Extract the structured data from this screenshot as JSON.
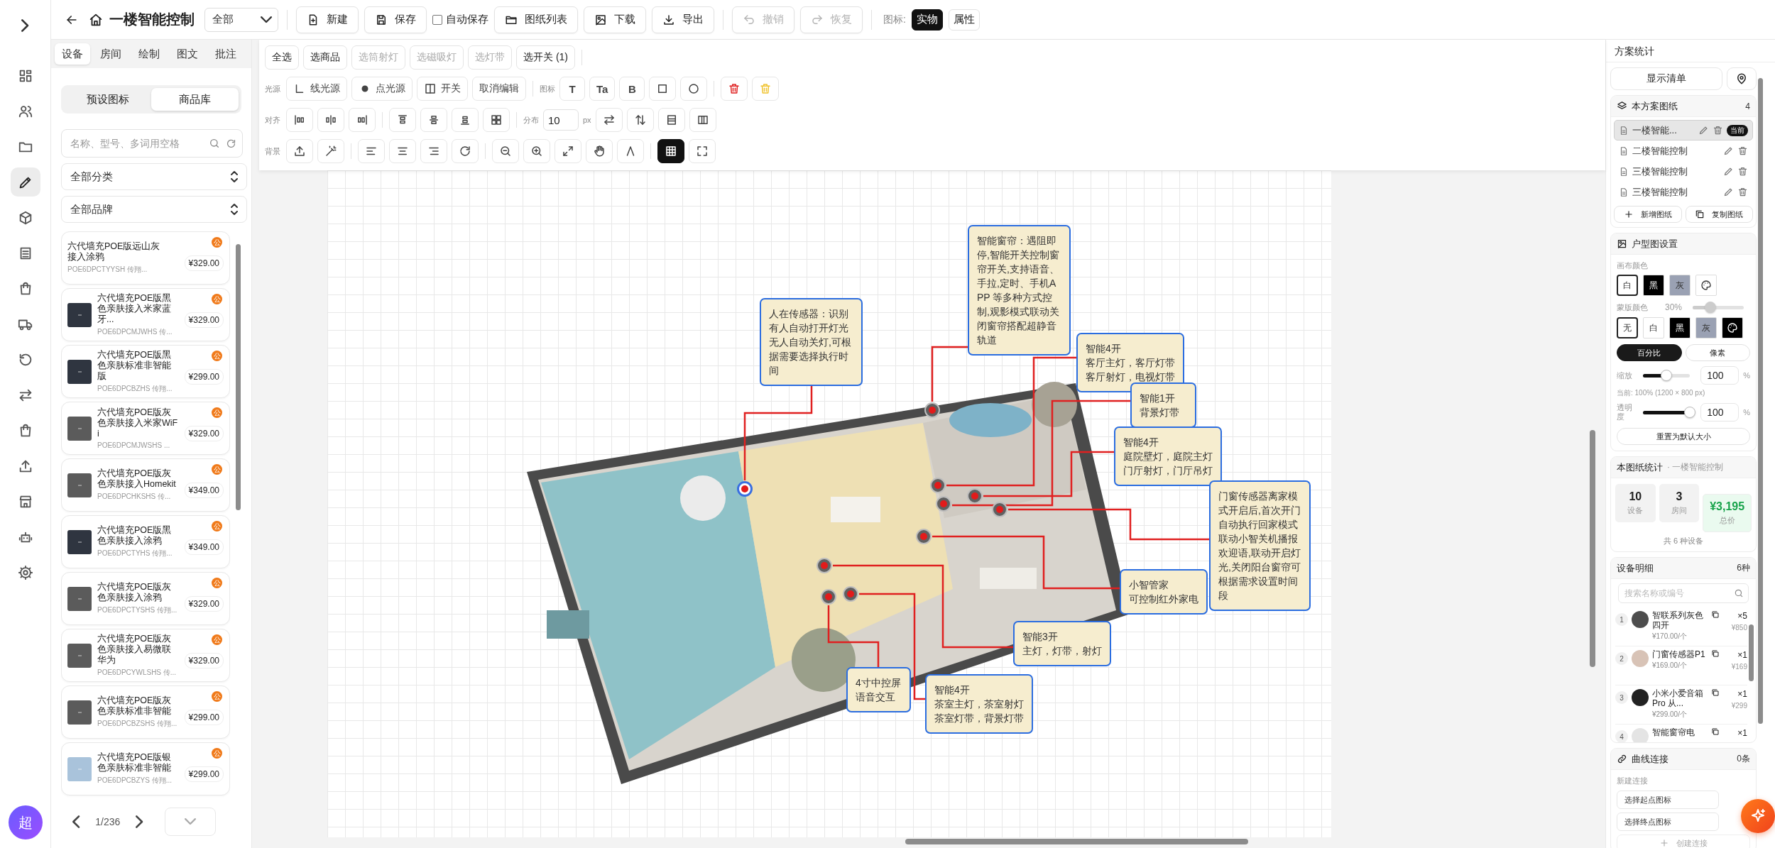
{
  "rail": {
    "items": [
      {
        "kind": "dashboard",
        "selected": false
      },
      {
        "kind": "users",
        "selected": false
      },
      {
        "kind": "folder",
        "selected": false
      },
      {
        "kind": "pen",
        "selected": true
      },
      {
        "kind": "cube",
        "selected": false
      },
      {
        "kind": "archive",
        "selected": false
      },
      {
        "kind": "bag",
        "selected": false
      },
      {
        "kind": "truck",
        "selected": false
      },
      {
        "kind": "history",
        "selected": false
      },
      {
        "kind": "swap",
        "selected": false
      },
      {
        "kind": "bag",
        "selected": false
      },
      {
        "kind": "upload",
        "selected": false
      },
      {
        "kind": "store",
        "selected": false
      },
      {
        "kind": "robot",
        "selected": false
      },
      {
        "kind": "settings",
        "selected": false
      }
    ],
    "avatar": "超"
  },
  "topbar": {
    "title": "一楼智能控制",
    "scope": "全部",
    "actions": [
      {
        "kind": "new",
        "label": "新建"
      },
      {
        "kind": "save",
        "label": "保存"
      },
      {
        "kind": "checkbox",
        "label": "自动保存",
        "checked": false
      },
      {
        "kind": "list",
        "label": "图纸列表"
      },
      {
        "kind": "download",
        "label": "下载"
      },
      {
        "kind": "export",
        "label": "导出"
      }
    ],
    "history": [
      {
        "kind": "undo",
        "label": "撤销",
        "disabled": true
      },
      {
        "kind": "redo",
        "label": "恢复",
        "disabled": true
      }
    ],
    "icon_mode_label": "图标:",
    "icon_modes": [
      {
        "label": "实物",
        "selected": true
      },
      {
        "label": "属性",
        "selected": false
      }
    ]
  },
  "left_panel": {
    "tabs": [
      {
        "label": "设备",
        "selected": true
      },
      {
        "label": "房间",
        "selected": false
      },
      {
        "label": "绘制",
        "selected": false
      },
      {
        "label": "图文",
        "selected": false
      },
      {
        "label": "批注",
        "selected": false
      }
    ],
    "sources": [
      {
        "label": "预设图标",
        "selected": false
      },
      {
        "label": "商品库",
        "selected": true
      }
    ],
    "search": {
      "placeholder": "名称、型号、多词用空格"
    },
    "filters": [
      "全部分类",
      "全部品牌"
    ],
    "products": [
      {
        "name": "六代墙充POE版远山灰接入涂鸦",
        "code": "POE6DPCTYYSH 传翔...",
        "price": "¥329.00",
        "badge": "公"
      },
      {
        "name": "六代墙充POE版黑色亲肤接入米家蓝牙...",
        "code": "POE6DPCMJWHS 传...",
        "price": "¥329.00",
        "badge": "公",
        "color": "#2f3540"
      },
      {
        "name": "六代墙充POE版黑色亲肤标准非智能版",
        "code": "POE6DPCBZHS 传翔...",
        "price": "¥299.00",
        "badge": "公",
        "color": "#2f3540"
      },
      {
        "name": "六代墙充POE版灰色亲肤接入米家WiFi",
        "code": "POE6DPCMJWSHS ...",
        "price": "¥329.00",
        "badge": "公",
        "color": "#5b5b5b"
      },
      {
        "name": "六代墙充POE版灰色亲肤接入Homekit",
        "code": "POE6DPCHKSHS 传...",
        "price": "¥349.00",
        "badge": "公",
        "color": "#5b5b5b"
      },
      {
        "name": "六代墙充POE版黑色亲肤接入涂鸦",
        "code": "POE6DPCTYHS 传翔...",
        "price": "¥349.00",
        "badge": "公",
        "color": "#2f3540"
      },
      {
        "name": "六代墙充POE版灰色亲肤接入涂鸦",
        "code": "POE6DPCTYSHS 传翔...",
        "price": "¥329.00",
        "badge": "公",
        "color": "#5b5b5b"
      },
      {
        "name": "六代墙充POE版灰色亲肤接入易微联华为",
        "code": "POE6DPCYWLSHS 传...",
        "price": "¥329.00",
        "badge": "公",
        "color": "#5b5b5b"
      },
      {
        "name": "六代墙充POE版灰色亲肤标准非智能",
        "code": "POE6DPCBZSHS 传翔...",
        "price": "¥299.00",
        "badge": "公",
        "color": "#5b5b5b"
      },
      {
        "name": "六代墙充POE版银色亲肤标准非智能",
        "code": "POE6DPCBZYS 传翔...",
        "price": "¥299.00",
        "badge": "公",
        "color": "#a9c3db"
      }
    ],
    "pagination": {
      "page": "1/236"
    }
  },
  "toolbar": {
    "selection": [
      {
        "label": "全选",
        "disabled": false
      },
      {
        "label": "选商品",
        "disabled": false
      },
      {
        "label": "选筒射灯",
        "disabled": true
      },
      {
        "label": "选磁吸灯",
        "disabled": true
      },
      {
        "label": "选灯带",
        "disabled": true
      },
      {
        "label": "选开关 (1)",
        "disabled": false
      }
    ],
    "rows": [
      {
        "label": "光源",
        "groups": [
          [
            {
              "kind": "line-light",
              "label": "线光源"
            },
            {
              "kind": "point-light",
              "label": "点光源"
            },
            {
              "kind": "switch",
              "label": "开关"
            },
            {
              "kind": "plain",
              "label": "取消编辑"
            }
          ],
          [
            {
              "kind": "caption",
              "label": "图标"
            },
            {
              "kind": "glyph",
              "label": "T"
            },
            {
              "kind": "glyph",
              "label": "Ta"
            },
            {
              "kind": "glyph",
              "label": "B"
            },
            {
              "kind": "square"
            },
            {
              "kind": "circle"
            }
          ],
          [
            {
              "kind": "delete"
            },
            {
              "kind": "delete-soft"
            }
          ]
        ]
      },
      {
        "label": "对齐",
        "groups": [
          [
            {
              "kind": "align-left"
            },
            {
              "kind": "align-center"
            },
            {
              "kind": "align-right"
            }
          ],
          [
            {
              "kind": "align-top"
            },
            {
              "kind": "align-middle"
            },
            {
              "kind": "align-bottom"
            },
            {
              "kind": "tile"
            }
          ],
          [
            {
              "kind": "caption",
              "label": "分布"
            },
            {
              "kind": "number",
              "value": "10",
              "unit": "px"
            },
            {
              "kind": "swap-horizontal"
            },
            {
              "kind": "swap-vertical"
            },
            {
              "kind": "rows"
            },
            {
              "kind": "columns"
            }
          ]
        ]
      },
      {
        "label": "背景",
        "groups": [
          [
            {
              "kind": "upload",
              "on": false
            },
            {
              "kind": "magic",
              "on": false
            }
          ],
          [
            {
              "kind": "text-left",
              "on": false
            },
            {
              "kind": "text-center",
              "on": false
            },
            {
              "kind": "text-right",
              "on": false
            },
            {
              "kind": "rotate",
              "on": false
            }
          ],
          [
            {
              "kind": "zoom-out",
              "on": false
            },
            {
              "kind": "zoom-in",
              "on": false
            },
            {
              "kind": "fit",
              "on": false
            },
            {
              "kind": "hand",
              "on": false
            },
            {
              "kind": "measure",
              "on": false
            }
          ],
          [
            {
              "kind": "grid",
              "on": true
            },
            {
              "kind": "fullscreen",
              "on": false
            }
          ]
        ]
      }
    ]
  },
  "canvas": {
    "devices": [
      {
        "selected": false
      },
      {
        "selected": true
      },
      {
        "selected": false
      },
      {
        "selected": false
      },
      {
        "selected": false
      },
      {
        "selected": false
      },
      {
        "selected": false
      },
      {
        "selected": false
      },
      {
        "selected": false
      },
      {
        "selected": false
      }
    ],
    "notes": [
      {
        "kind": "wrapped",
        "lines": [
          "人在传感器：识别有人自动打开灯光无人自动关灯,可根据需要选择执行时间"
        ]
      },
      {
        "kind": "wrapped",
        "lines": [
          "智能窗帘：遇阻即停,智能开关控制窗帘开关,支持语音、手拉,定时、手机APP 等多种方式控制,观影模式联动关闭窗帘搭配超静音轨道"
        ]
      },
      {
        "kind": "lines",
        "lines": [
          "智能4开",
          "客厅主灯，客厅灯带",
          "客厅射灯，电视灯带"
        ]
      },
      {
        "kind": "lines",
        "lines": [
          "智能1开",
          "背景灯带"
        ]
      },
      {
        "kind": "lines",
        "lines": [
          "智能4开",
          "庭院壁灯，庭院主灯",
          "门厅射灯，门厅吊灯"
        ]
      },
      {
        "kind": "lines",
        "lines": [
          "小智管家",
          "可控制红外家电"
        ]
      },
      {
        "kind": "wrapped",
        "lines": [
          "门窗传感器离家模式开启后,首次开门自动执行回家模式联动小智关机播报欢迎语,联动开启灯光,关闭阳台窗帘可根据需求设置时间段"
        ]
      },
      {
        "kind": "lines",
        "lines": [
          "4寸中控屏",
          "语音交互"
        ]
      },
      {
        "kind": "lines",
        "lines": [
          "智能4开",
          "茶室主灯，茶室射灯",
          "茶室灯带，背景灯带"
        ]
      },
      {
        "kind": "lines",
        "lines": [
          "智能3开",
          "主灯，灯带，射灯"
        ]
      }
    ]
  },
  "right_panel": {
    "title": "方案统计",
    "show_list": "显示清单",
    "drawings": {
      "title": "本方案图纸",
      "count": "4",
      "items": [
        {
          "name": "一楼智能...",
          "selected": true,
          "badge": "当前"
        },
        {
          "name": "二楼智能控制",
          "selected": false
        },
        {
          "name": "三楼智能控制",
          "selected": false
        },
        {
          "name": "三楼智能控制",
          "selected": false
        }
      ],
      "add": "新增图纸",
      "copy": "复制图纸"
    },
    "floorplan": {
      "title": "户型图设置",
      "canvas_label": "画布颜色",
      "canvas_colors": [
        {
          "kind": "swatch",
          "label": "白",
          "color": "#ffffff",
          "selected": true
        },
        {
          "kind": "swatch",
          "label": "黑",
          "color": "#000000",
          "selected": false
        },
        {
          "kind": "swatch",
          "label": "灰",
          "color": "#9aa1b3",
          "selected": false
        },
        {
          "kind": "palette",
          "color": "#ffffff",
          "selected": false
        }
      ],
      "mask_label": "蒙版颜色",
      "mask_opacity": "30%",
      "mask_slider": {
        "level": 0.35
      },
      "mask_colors": [
        {
          "kind": "swatch",
          "label": "无",
          "color": "#ffffff",
          "selected": true
        },
        {
          "kind": "swatch",
          "label": "白",
          "color": "#ffffff",
          "selected": false
        },
        {
          "kind": "swatch",
          "label": "黑",
          "color": "#000000",
          "selected": false
        },
        {
          "kind": "swatch",
          "label": "灰",
          "color": "#9aa1b3",
          "selected": false
        },
        {
          "kind": "palette",
          "color": "#000000",
          "selected": false
        }
      ],
      "units": [
        {
          "label": "百分比",
          "selected": true
        },
        {
          "label": "像素",
          "selected": false
        }
      ],
      "scale": {
        "label": "缩放",
        "level": 0.5,
        "value": "100",
        "unit": "%"
      },
      "current": "当前: 100% (1200 × 800 px)",
      "opacity": {
        "label": "透明度",
        "level": 1,
        "value": "100",
        "unit": "%"
      },
      "reset": "重置为默认大小"
    },
    "stats": {
      "title": "本图纸统计",
      "subtitle": "· 一楼智能控制",
      "items": [
        {
          "kind": "count",
          "value": "10",
          "label": "设备"
        },
        {
          "kind": "count",
          "value": "3",
          "label": "房间"
        },
        {
          "kind": "price",
          "value": "¥3,195",
          "label": "总价"
        }
      ],
      "summary": "共 6 种设备"
    },
    "details": {
      "title": "设备明细",
      "count": "6种",
      "placeholder": "搜索名称或编号",
      "items": [
        {
          "index": "1",
          "name": "智联系列灰色四开",
          "unit_price": "¥170.00/个",
          "qty": "×5",
          "total": "¥850",
          "color": "#4d4d4d"
        },
        {
          "index": "2",
          "name": "门窗传感器P1",
          "unit_price": "¥169.00/个",
          "qty": "×1",
          "total": "¥169",
          "color": "#d8c3b6"
        },
        {
          "index": "3",
          "name": "小米小爱音箱 Pro 从...",
          "unit_price": "¥299.00/个",
          "qty": "×1",
          "total": "¥299",
          "color": "#222222"
        },
        {
          "index": "4",
          "name": "智能窗帘电",
          "qty": "×1",
          "color": "#e4e4e4"
        }
      ]
    },
    "connections": {
      "title": "曲线连接",
      "count": "0条",
      "new_label": "新建连接",
      "start": "选择起点图标",
      "end": "选择终点图标",
      "create": "创建连接"
    }
  }
}
